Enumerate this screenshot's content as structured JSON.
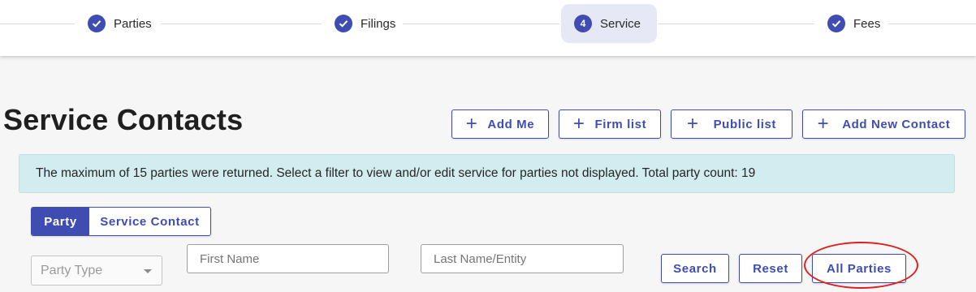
{
  "stepper": {
    "steps": [
      {
        "label": "Parties",
        "state": "done"
      },
      {
        "label": "Filings",
        "state": "done"
      },
      {
        "number": "4",
        "label": "Service",
        "state": "active"
      },
      {
        "label": "Fees",
        "state": "done"
      }
    ]
  },
  "page": {
    "title": "Service Contacts"
  },
  "actions": {
    "add_me": "Add Me",
    "firm_list": "Firm list",
    "public_list": "Public list",
    "add_new_contact": "Add New Contact"
  },
  "alert": {
    "message": "The maximum of 15 parties were returned. Select a filter to view and/or edit service for parties not displayed. Total party count: 19"
  },
  "toggle": {
    "party": "Party",
    "service_contact": "Service Contact",
    "selected": "Party"
  },
  "filters": {
    "party_type_placeholder": "Party Type",
    "first_name_placeholder": "First Name",
    "last_name_placeholder": "Last Name/Entity",
    "search": "Search",
    "reset": "Reset",
    "all_parties": "All Parties"
  },
  "colors": {
    "primary": "#3f4db3",
    "alert_bg": "#d2ecef",
    "highlight": "#e02020"
  }
}
